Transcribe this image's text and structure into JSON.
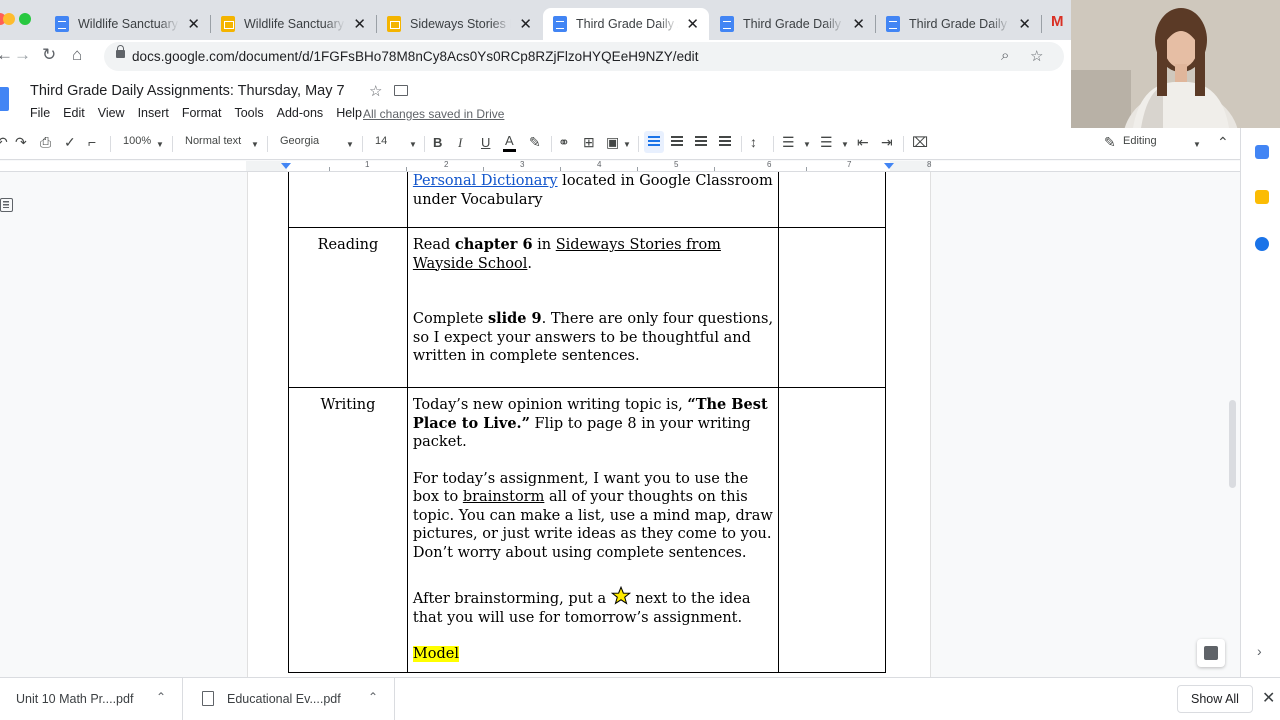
{
  "browser": {
    "tabs": [
      {
        "title": "Wildlife Sanctuary T",
        "app": "docs",
        "active": false
      },
      {
        "title": "Wildlife Sanctuary A",
        "app": "slides",
        "active": false
      },
      {
        "title": "Sideways Stories Fr",
        "app": "slides",
        "active": false
      },
      {
        "title": "Third Grade Daily A",
        "app": "docs",
        "active": true
      },
      {
        "title": "Third Grade Daily A",
        "app": "docs",
        "active": false
      },
      {
        "title": "Third Grade Daily A",
        "app": "docs",
        "active": false
      }
    ],
    "url": "docs.google.com/document/d/1FGFsBHo78M8nCy8Acs0Ys0RCp8RZjFlzoHYQEeH9NZY/edit",
    "gmail_letter": "M",
    "icons": [
      "back-icon",
      "forward-icon",
      "reload-icon",
      "home-icon",
      "lock-icon",
      "zoom-icon",
      "bookmark-star-icon",
      "close-icon"
    ]
  },
  "doc": {
    "title": "Third Grade Daily Assignments: Thursday, May 7",
    "menu": [
      "File",
      "Edit",
      "View",
      "Insert",
      "Format",
      "Tools",
      "Add-ons",
      "Help"
    ],
    "save_status": "All changes saved in Drive"
  },
  "toolbar": {
    "zoom": "100%",
    "style": "Normal text",
    "font": "Georgia",
    "size": "14",
    "bold": "B",
    "italic": "I",
    "underline": "U",
    "text_color": "A",
    "mode": "Editing"
  },
  "ruler": {
    "numbers": [
      "1",
      "2",
      "3",
      "4",
      "5",
      "6",
      "7",
      "8"
    ]
  },
  "table": {
    "vocab": {
      "link": "Personal Dictionary",
      "text": " located in Google Classroom under Vocabulary"
    },
    "reading": {
      "subject": "Reading",
      "p1_a": "Read ",
      "p1_b": "chapter 6",
      "p1_c": " in ",
      "p1_link": "Sideways Stories from Wayside School",
      "p1_d": ".",
      "p2_a": "Complete ",
      "p2_b": "slide 9",
      "p2_c": ". There are only four questions, so I expect your answers to be thoughtful and written in complete sentences."
    },
    "writing": {
      "subject": "Writing",
      "p1_a": "Today’s new opinion writing topic is, ",
      "p1_b": "“The Best Place to Live.”",
      "p1_c": " Flip to page 8 in your writing packet.",
      "p2_a": "For today’s assignment, I want you to use the box to ",
      "p2_u": "brainstorm",
      "p2_b": " all of your thoughts on this topic. You can make a list, use a mind map, draw pictures, or just write ideas as they come to you. Don’t worry about using complete sentences.",
      "p3_a": "After brainstorming, put a ",
      "p3_b": " next to the idea that you will use for tomorrow’s assignment.",
      "model": "Model"
    }
  },
  "downloads": {
    "items": [
      "Unit 10 Math Pr....pdf",
      "Educational Ev....pdf"
    ],
    "show_all": "Show All"
  },
  "colors": {
    "docs_blue": "#4285f4",
    "slides_yellow": "#f4b400",
    "highlight": "#ffff00",
    "link": "#1155cc"
  }
}
